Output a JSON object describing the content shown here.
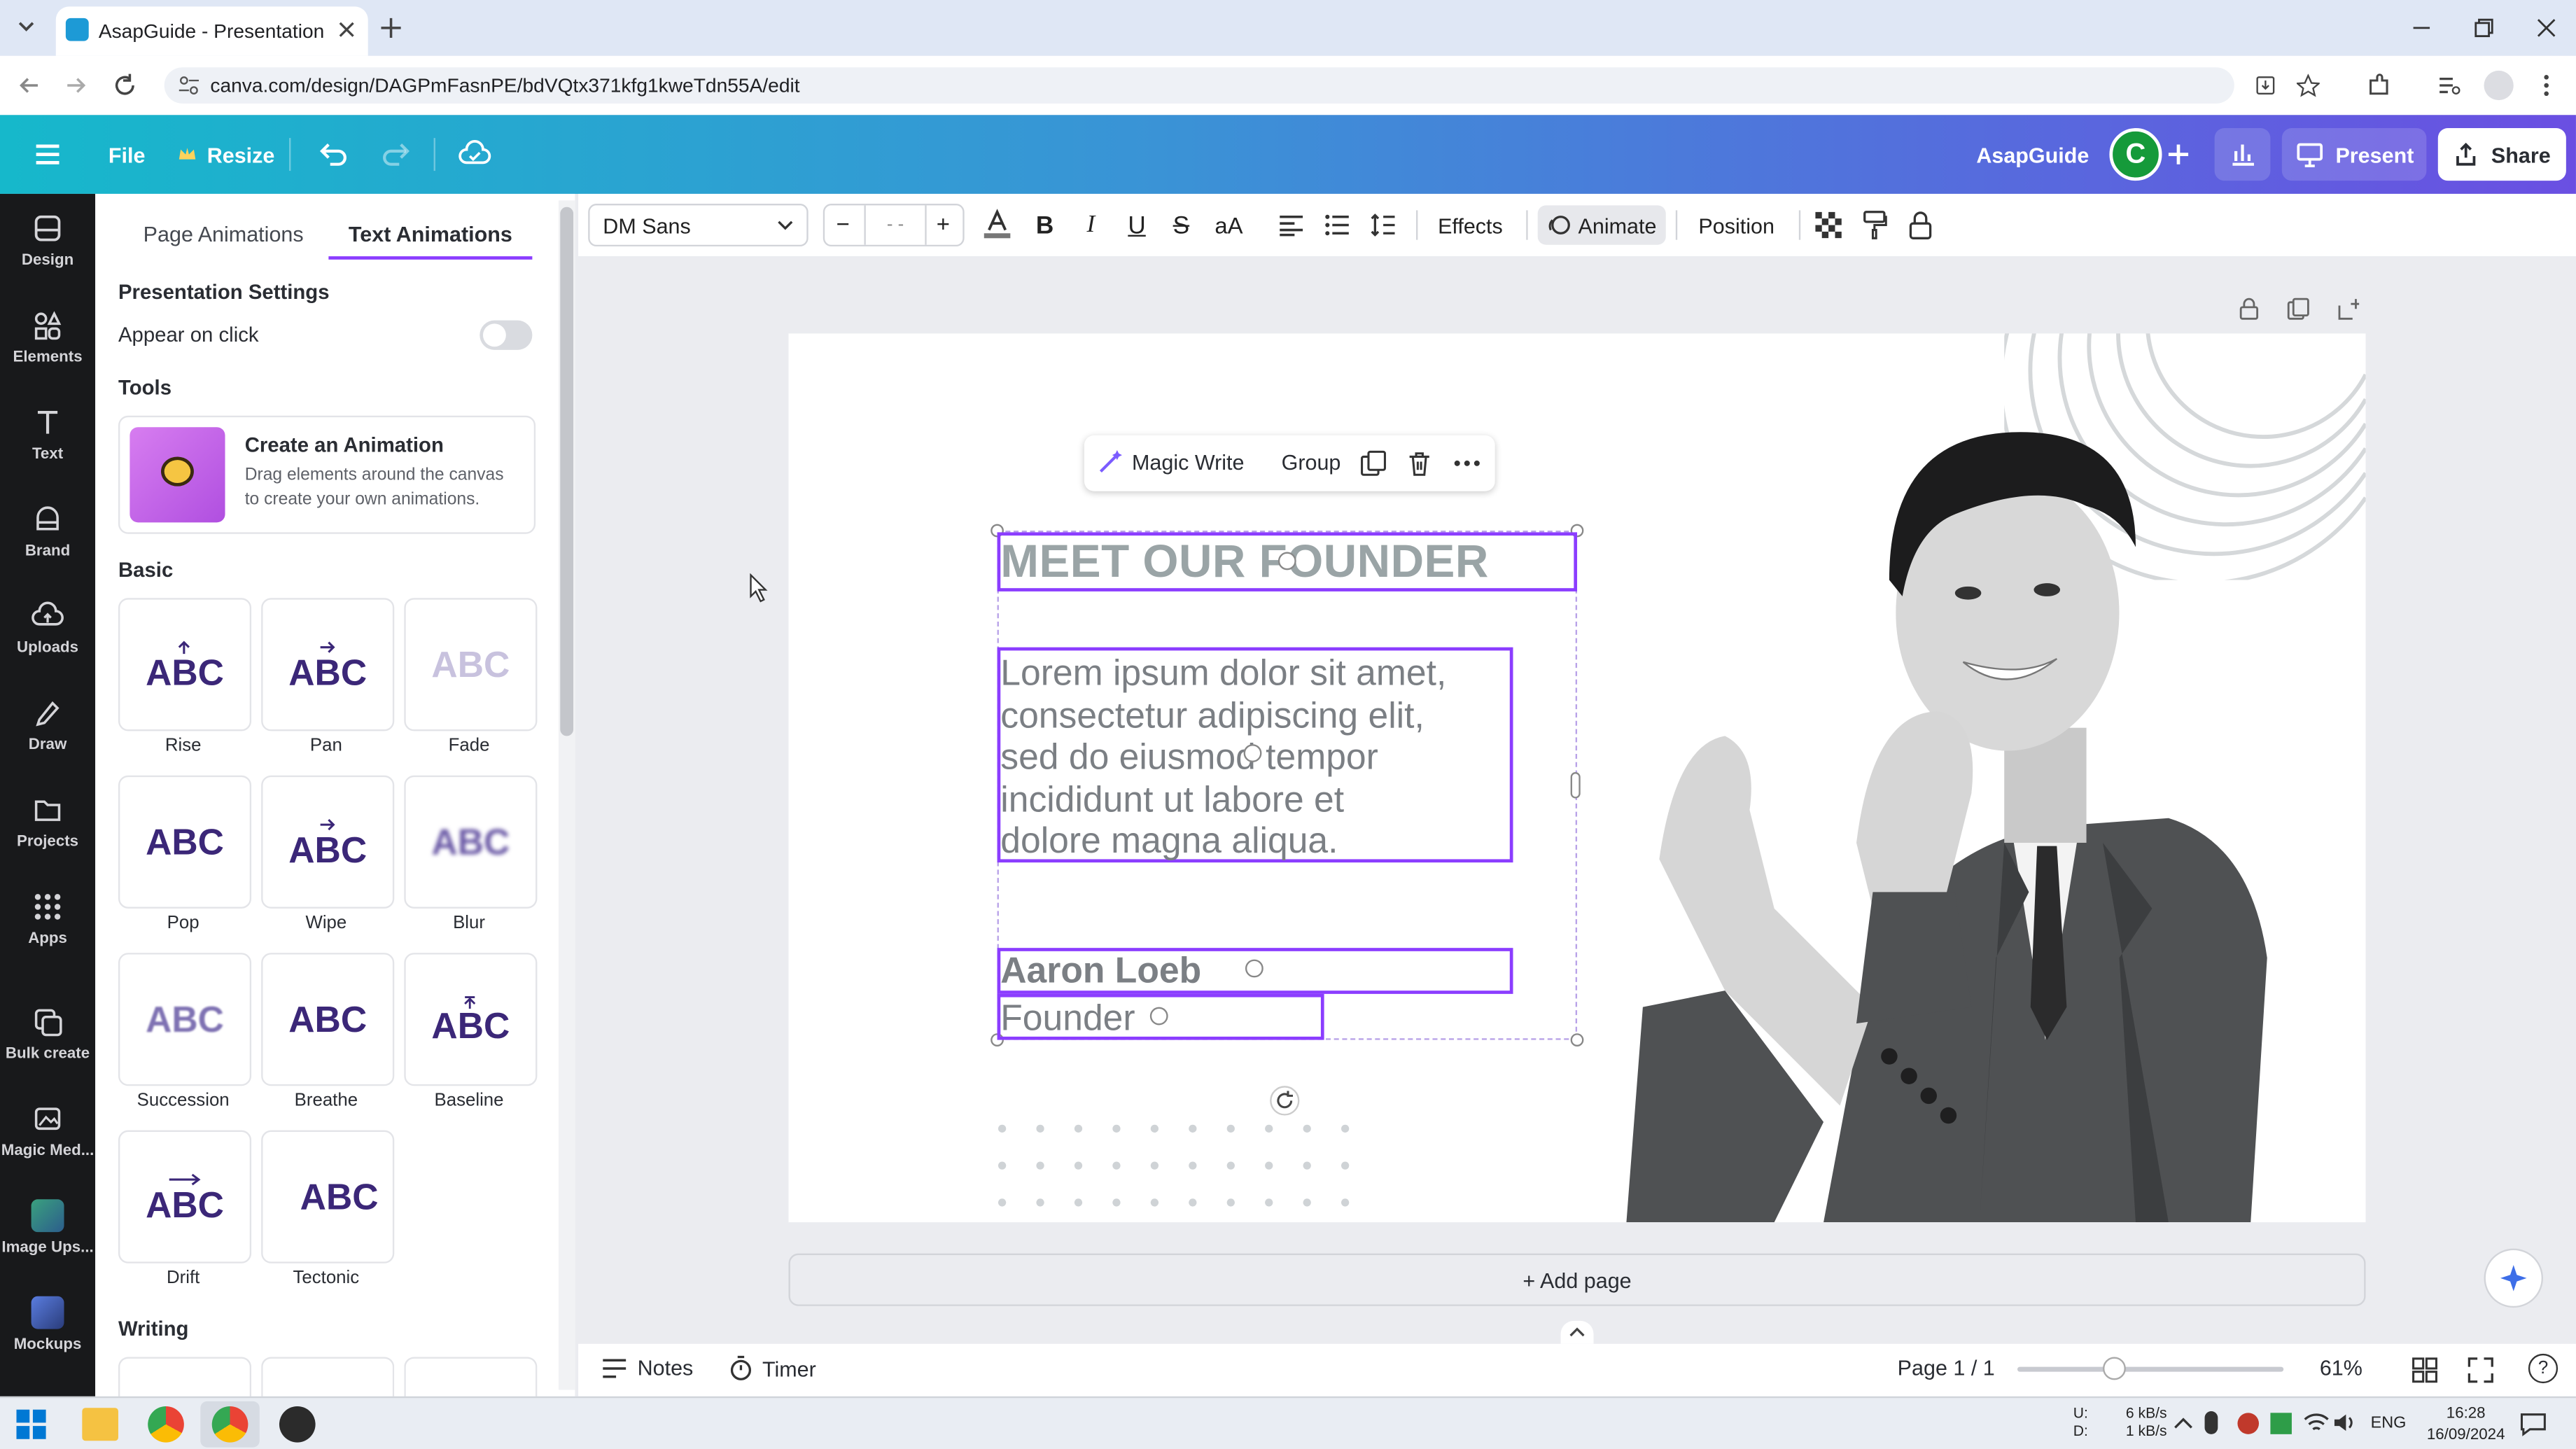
{
  "browser": {
    "tab_title": "AsapGuide - Presentation",
    "url": "canva.com/design/DAGPmFasnPE/bdVQtx371kfg1kweTdn55A/edit"
  },
  "header": {
    "file": "File",
    "resize": "Resize",
    "team_name": "AsapGuide",
    "avatar_letter": "C",
    "present": "Present",
    "share": "Share"
  },
  "sidenav": {
    "items": [
      "Design",
      "Elements",
      "Text",
      "Brand",
      "Uploads",
      "Draw",
      "Projects",
      "Apps",
      "Bulk create",
      "Magic Med...",
      "Image Ups...",
      "Mockups"
    ]
  },
  "panel": {
    "tabs": [
      "Page Animations",
      "Text Animations"
    ],
    "presentation_settings": "Presentation Settings",
    "appear_on_click": "Appear on click",
    "tools": "Tools",
    "create_title": "Create an Animation",
    "create_desc": "Drag elements around the canvas to create your own animations.",
    "basic": "Basic",
    "card_text": "ABC",
    "animations": [
      "Rise",
      "Pan",
      "Fade",
      "Pop",
      "Wipe",
      "Blur",
      "Succession",
      "Breathe",
      "Baseline",
      "Drift",
      "Tectonic"
    ],
    "writing": "Writing"
  },
  "editbar": {
    "font": "DM Sans",
    "minus": "−",
    "size": "- -",
    "plus": "+",
    "bold": "B",
    "italic": "I",
    "underline": "U",
    "strike": "S",
    "case": "aA",
    "effects": "Effects",
    "animate": "Animate",
    "position": "Position"
  },
  "float_toolbar": {
    "magic_write": "Magic Write",
    "group": "Group"
  },
  "slide": {
    "title": "MEET OUR FOUNDER",
    "body_lines": [
      "Lorem ipsum dolor sit amet,",
      "consectetur adipiscing elit,",
      "sed do eiusmod tempor",
      "incididunt ut labore et",
      "dolore magna aliqua."
    ],
    "name": "Aaron Loeb",
    "role": "Founder"
  },
  "canvas": {
    "add_page": "+ Add page"
  },
  "footer": {
    "notes": "Notes",
    "timer": "Timer",
    "page": "Page 1 / 1",
    "zoom": "61%",
    "zoom_fraction": 0.61
  },
  "taskbar": {
    "net_up_label": "U:",
    "net_down_label": "D:",
    "net_up": "6 kB/s",
    "net_down": "1 kB/s",
    "lang": "ENG",
    "time": "16:28",
    "date": "16/09/2024"
  },
  "colors": {
    "accent": "#8b3dff",
    "purple_text": "#3b2778",
    "title_gray": "#9aa4a6",
    "body_gray": "#7b7f84",
    "sidebar": "#18191b"
  }
}
